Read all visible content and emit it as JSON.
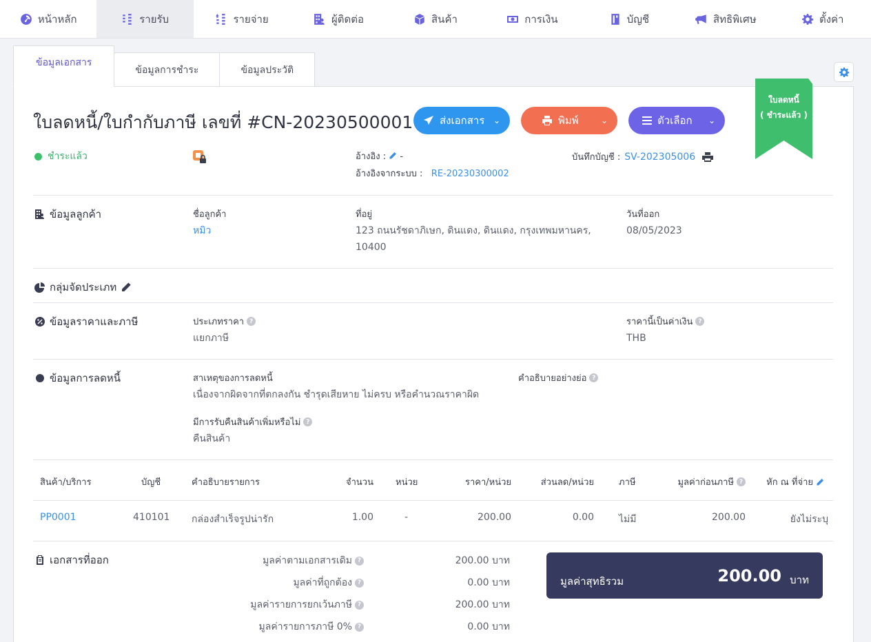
{
  "nav": {
    "items": [
      {
        "label": "หน้าหลัก",
        "icon": "dashboard-icon"
      },
      {
        "label": "รายรับ",
        "icon": "income-icon"
      },
      {
        "label": "รายจ่าย",
        "icon": "expense-icon"
      },
      {
        "label": "ผู้ติดต่อ",
        "icon": "contacts-icon"
      },
      {
        "label": "สินค้า",
        "icon": "box-icon"
      },
      {
        "label": "การเงิน",
        "icon": "money-icon"
      },
      {
        "label": "บัญชี",
        "icon": "book-icon"
      },
      {
        "label": "สิทธิพิเศษ",
        "icon": "megaphone-icon"
      },
      {
        "label": "ตั้งค่า",
        "icon": "gear-icon"
      }
    ],
    "active_index": 1
  },
  "tabs": [
    "ข้อมูลเอกสาร",
    "ข้อมูลการชำระ",
    "ข้อมูลประวัติ"
  ],
  "ribbon": {
    "line1": "ใบลดหนี้",
    "line2": "( ชำระแล้ว )",
    "color": "#3fbf6e"
  },
  "document": {
    "title": "ใบลดหนี้/ใบกำกับภาษี เลขที่ #CN-20230500001",
    "status": "ชำระแล้ว",
    "reference_label": "อ้างอิง :",
    "reference_value": "-",
    "system_reference_label": "อ้างอิงจากระบบ :",
    "system_reference_value": "RE-20230300002",
    "journal_label": "บันทึกบัญชี :",
    "journal_value": "SV-202305006"
  },
  "buttons": {
    "send": "ส่งเอกสาร",
    "print": "พิมพ์",
    "options": "ตัวเลือก"
  },
  "customer": {
    "section": "ข้อมูลลูกค้า",
    "name_label": "ชื่อลูกค้า",
    "name": "หมิว",
    "address_label": "ที่อยู่",
    "address_line1": "123 ถนนรัชดาภิเษก, ดินแดง, ดินแดง, กรุงเทพมหานคร,",
    "address_line2": "10400",
    "issue_date_label": "วันที่ออก",
    "issue_date": "08/05/2023"
  },
  "category": {
    "section": "กลุ่มจัดประเภท"
  },
  "pricing": {
    "section": "ข้อมูลราคาและภาษี",
    "price_type_label": "ประเภทราคา",
    "price_type": "แยกภาษี",
    "currency_label": "ราคานี้เป็นค่าเงิน",
    "currency": "THB"
  },
  "credit": {
    "section": "ข้อมูลการลดหนี้",
    "reason_label": "สาเหตุของการลดหนี้",
    "reason": "เนื่องจากผิดจากที่ตกลงกัน ชำรุดเสียหาย ไม่ครบ หรือคำนวณราคาผิด",
    "desc_label": "คำอธิบายอย่างย่อ",
    "return_label": "มีการรับคืนสินค้าเพิ่มหรือไม่",
    "return_value": "คืนสินค้า"
  },
  "table": {
    "headers": [
      "สินค้า/บริการ",
      "บัญชี",
      "คำอธิบายรายการ",
      "จำนวน",
      "หน่วย",
      "ราคา/หน่วย",
      "ส่วนลด/หน่วย",
      "ภาษี",
      "มูลค่าก่อนภาษี",
      "หัก ณ ที่จ่าย"
    ],
    "rows": [
      [
        "PP0001",
        "410101",
        "กล่องสำเร็จรูปน่ารัก",
        "1.00",
        "-",
        "200.00",
        "0.00",
        "ไม่มี",
        "200.00",
        "ยังไม่ระบุ"
      ]
    ]
  },
  "issued_docs": {
    "section": "เอกสารที่ออก"
  },
  "summary": {
    "lines": [
      {
        "label": "มูลค่าตามเอกสารเดิม",
        "value": "200.00 บาท"
      },
      {
        "label": "มูลค่าที่ถูกต้อง",
        "value": "0.00 บาท"
      },
      {
        "label": "มูลค่ารายการยกเว้นภาษี",
        "value": "200.00 บาท"
      },
      {
        "label": "มูลค่ารายการภาษี 0%",
        "value": "0.00 บาท"
      }
    ],
    "net_label": "มูลค่าสุทธิรวม",
    "net_value": "200.00",
    "net_unit": "บาท"
  }
}
